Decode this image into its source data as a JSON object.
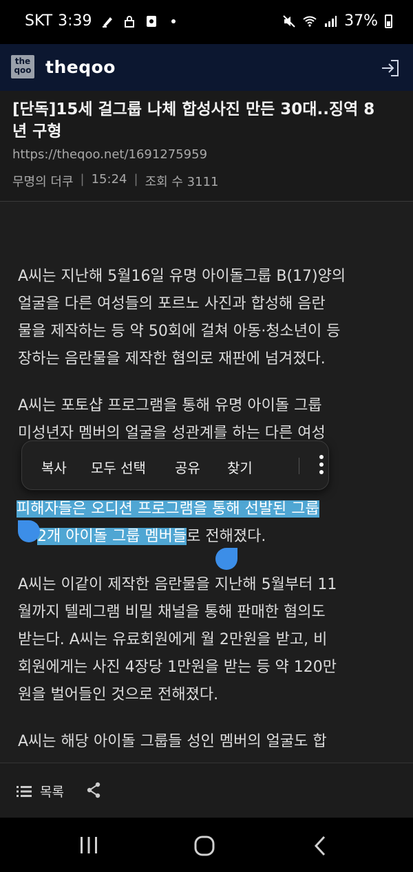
{
  "status_bar": {
    "carrier": "SKT",
    "time": "3:39",
    "battery": "37%"
  },
  "app": {
    "logo_text": "the qoo",
    "name": "theqoo"
  },
  "article": {
    "title_line1": "[단독]15세 걸그룹 나체 합성사진 만든 30대..징역 8",
    "title_line2": "년 구형",
    "url": "https://theqoo.net/1691275959",
    "author": "무명의 더쿠",
    "time": "15:24",
    "views": "조회 수 3111",
    "paragraphs": [
      [
        "A씨는 지난해 5월16일 유명 아이돌그룹 B(17)양의",
        "얼굴을 다른 여성들의 포르노 사진과 합성해 음란",
        "물을 제작하는 등 약 50회에 걸쳐 아동·청소년이 등",
        "장하는 음란물을 제작한 혐의로 재판에 넘겨졌다."
      ],
      [
        "A씨는 포토샵 프로그램을 통해 유명 아이돌 그룹",
        "미성년자 멤버의 얼굴을 성관계를 하는 다른 여성"
      ],
      [
        "A씨는 이같이 제작한 음란물을 지난해 5월부터 11",
        "월까지 텔레그램 비밀 채널을 통해 판매한 혐의도",
        "받는다. A씨는 유료회원에게 월 2만원을 받고, 비",
        "회원에게는 사진 4장당 1만원을 받는 등 약 120만",
        "원을 벌어들인 것으로 전해졌다."
      ],
      [
        "A씨는 해당 아이돌 그룹들 성인 멤버의 얼굴도 합"
      ]
    ],
    "highlight_line1": "피해자들은 오디션 프로그램을 통해 선발된 그룹",
    "highlight_line2_sel": "2개 아이돌 그룹 멤버들",
    "highlight_line2_rest": "로 전해졌다."
  },
  "context_menu": {
    "copy": "복사",
    "select_all": "모두 선택",
    "share": "공유",
    "find": "찾기"
  },
  "toolbar": {
    "list_label": "목록"
  }
}
